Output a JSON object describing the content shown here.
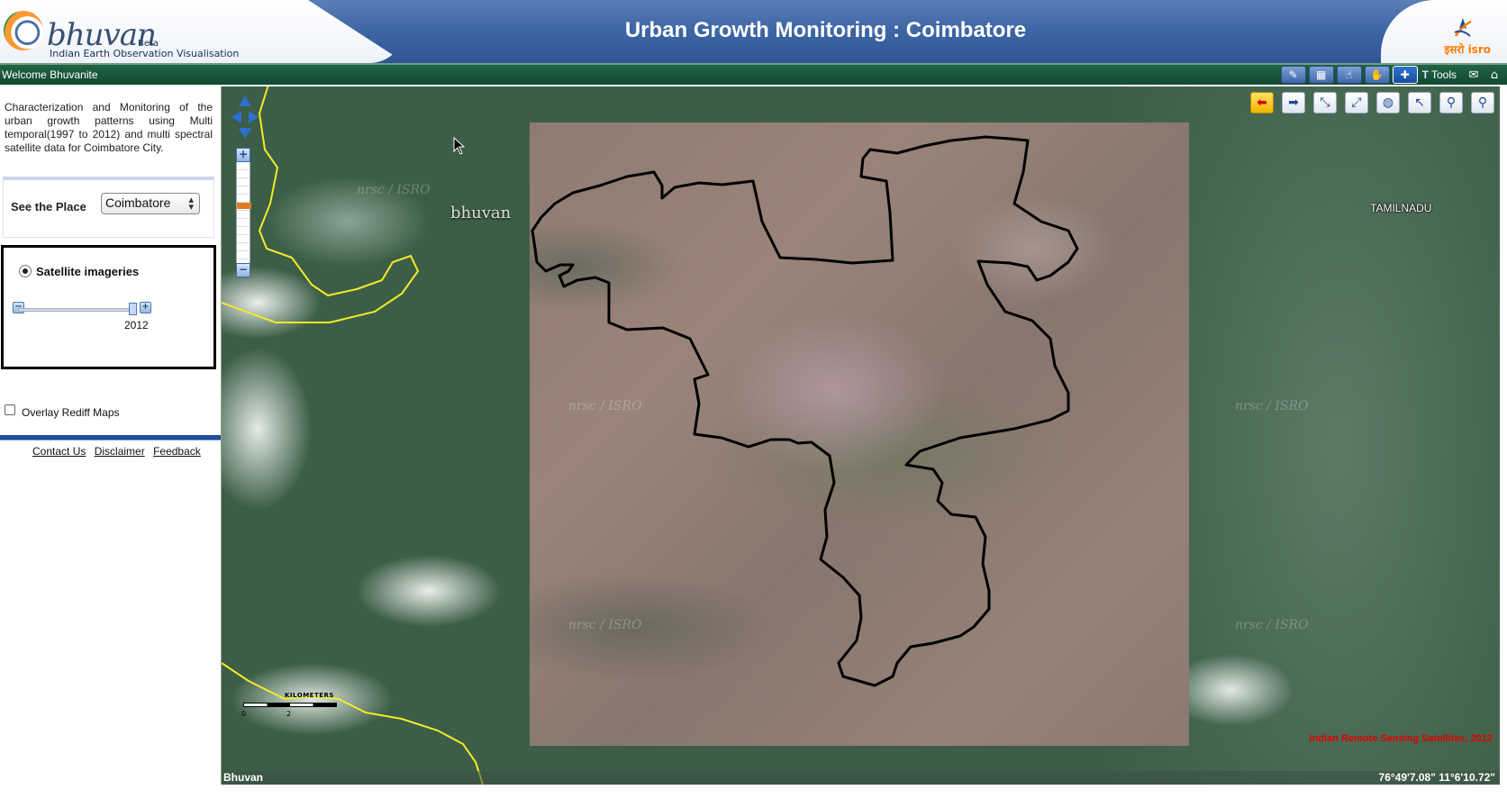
{
  "header": {
    "logo_text": "bhuvan",
    "logo_beta": "Beta",
    "logo_subtitle": "Indian Earth Observation Visualisation",
    "title": "Urban Growth Monitoring : Coimbatore",
    "isro_logo_text": "इसरो isro",
    "colors": {
      "header_blue": "#3f67a6",
      "subbar_green": "#114a31"
    }
  },
  "subbar": {
    "welcome": "Welcome Bhuvanite",
    "icons": [
      "pencil-icon",
      "layers-icon",
      "hand-pointer-icon",
      "pan-hand-icon",
      "crosshair-icon"
    ],
    "tools_label": "Tools",
    "extra_icons": [
      "mail-icon",
      "home-icon"
    ]
  },
  "sidebar": {
    "description": "Characterization and Monitoring of the urban growth patterns using Multi temporal(1997 to 2012) and multi spectral satellite data for Coimbatore City.",
    "place_label": "See the Place",
    "place_value": "Coimbatore",
    "satellite_label": "Satellite imageries",
    "satellite_selected": true,
    "slider_year": "2012",
    "slider_minus": "−",
    "slider_plus": "+",
    "overlay_label": "Overlay Rediff Maps",
    "overlay_checked": false,
    "links": [
      "Contact Us",
      "Disclaimer",
      "Feedback"
    ]
  },
  "map": {
    "tools": [
      "back-arrow-icon",
      "forward-arrow-icon",
      "zoom-extent-icon",
      "full-extent-icon",
      "globe-icon",
      "select-pointer-icon",
      "zoom-out-icon",
      "zoom-in-icon"
    ],
    "zoom_plus": "+",
    "zoom_minus": "−",
    "watermarks": [
      "nrsc / ISRO",
      "bhuvan"
    ],
    "state_label": "TAMILNADU",
    "scale_label": "KILOMETERS",
    "scale_ticks": [
      "0",
      "2"
    ],
    "credit": "Indian Remote Sensing Satellites, 2012",
    "status_left": "Bhuvan",
    "coordinates": "76°49'7.08\" 11°6'10.72\"",
    "boundary_color": "#000000",
    "state_border_color": "#f2ea2a",
    "credit_color": "#e00000"
  }
}
